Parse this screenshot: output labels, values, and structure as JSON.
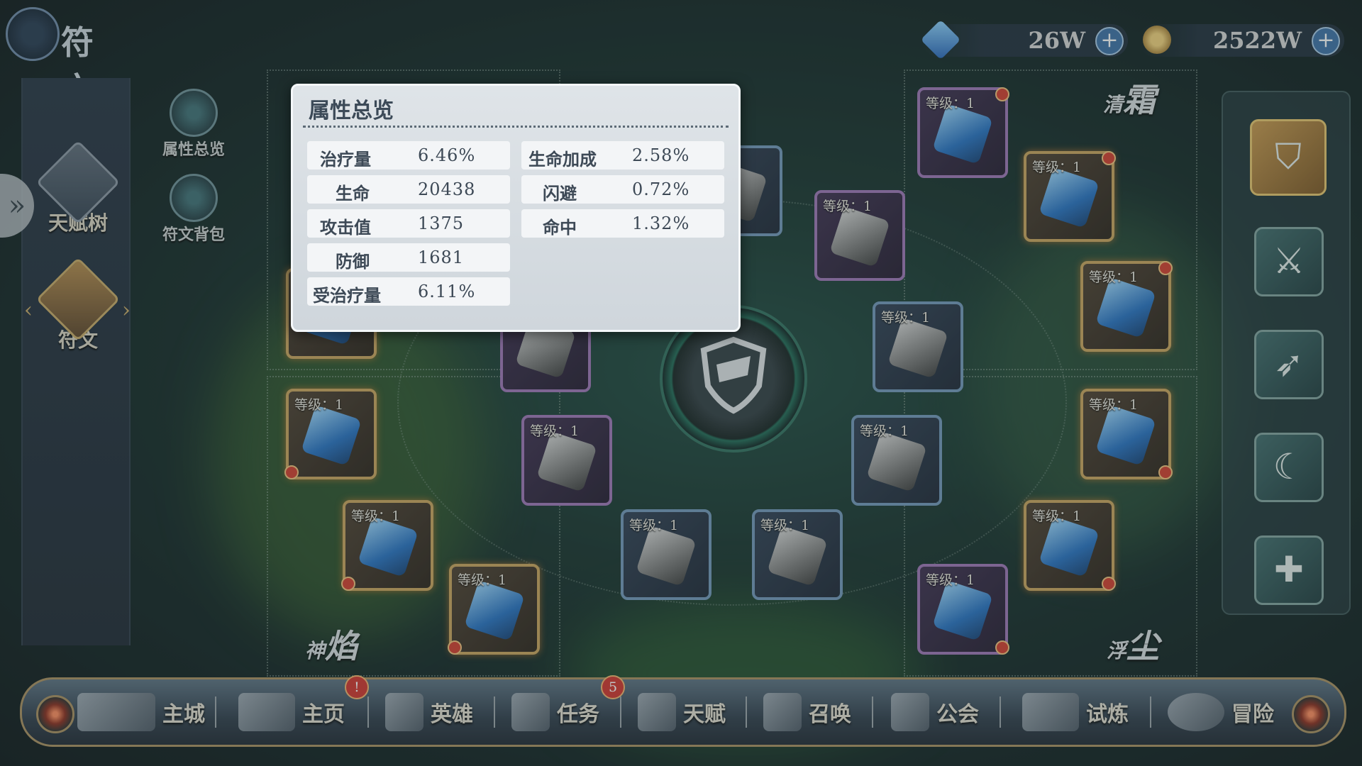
{
  "header": {
    "title": "符文"
  },
  "currency": [
    {
      "name": "gem",
      "icon": "gem-icon",
      "value": "26W"
    },
    {
      "name": "gold",
      "icon": "coin-icon",
      "value": "2522W"
    }
  ],
  "sidebar": {
    "items": [
      {
        "label": "天赋树",
        "icon": "pentagram-icon"
      },
      {
        "label": "符文",
        "icon": "rune-icon"
      }
    ],
    "sub_buttons": [
      {
        "label": "属性总览",
        "icon": "eye-icon"
      },
      {
        "label": "符文背包",
        "icon": "backpack-icon"
      }
    ]
  },
  "quadrants": {
    "top_right": {
      "big": "霜",
      "small": "清"
    },
    "bottom_left": {
      "big": "焰",
      "small": "神"
    },
    "bottom_right": {
      "big": "尘",
      "small": "浮"
    }
  },
  "slot_level_text": "等级：1",
  "right_column": {
    "buttons": [
      {
        "icon": "shield-icon",
        "active": true
      },
      {
        "icon": "sword-icon",
        "active": false
      },
      {
        "icon": "bow-icon",
        "active": false
      },
      {
        "icon": "staff-icon",
        "active": false
      },
      {
        "icon": "cross-icon",
        "active": false
      }
    ]
  },
  "bottom_nav": {
    "items": [
      {
        "label": "主城",
        "icon": "castle-icon"
      },
      {
        "label": "主页",
        "icon": "home-icon",
        "badge": "!"
      },
      {
        "label": "英雄",
        "icon": "hero-icon"
      },
      {
        "label": "任务",
        "icon": "quest-icon",
        "badge": "5"
      },
      {
        "label": "天赋",
        "icon": "talent-icon"
      },
      {
        "label": "召唤",
        "icon": "summon-icon"
      },
      {
        "label": "公会",
        "icon": "guild-icon"
      },
      {
        "label": "试炼",
        "icon": "trial-icon"
      },
      {
        "label": "冒险",
        "icon": "adventure-icon"
      }
    ]
  },
  "attr_panel": {
    "title": "属性总览",
    "left": [
      {
        "label": "治疗量",
        "value": "6.46%"
      },
      {
        "label": "生命",
        "value": "20438"
      },
      {
        "label": "攻击值",
        "value": "1375"
      },
      {
        "label": "防御",
        "value": "1681"
      },
      {
        "label": "受治疗量",
        "value": "6.11%"
      }
    ],
    "right": [
      {
        "label": "生命加成",
        "value": "2.58%"
      },
      {
        "label": "闪避",
        "value": "0.72%"
      },
      {
        "label": "命中",
        "value": "1.32%"
      }
    ]
  }
}
